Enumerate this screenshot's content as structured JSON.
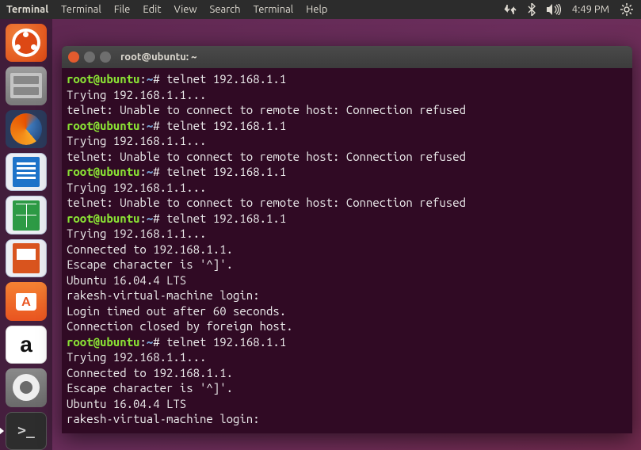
{
  "menubar": {
    "app": "Terminal",
    "items": [
      "Terminal",
      "File",
      "Edit",
      "View",
      "Search",
      "Terminal",
      "Help"
    ],
    "time": "4:49 PM"
  },
  "launcher": {
    "items": [
      {
        "name": "dash"
      },
      {
        "name": "files"
      },
      {
        "name": "firefox"
      },
      {
        "name": "writer"
      },
      {
        "name": "calc"
      },
      {
        "name": "impress"
      },
      {
        "name": "software"
      },
      {
        "name": "amazon"
      },
      {
        "name": "settings"
      },
      {
        "name": "terminal"
      }
    ]
  },
  "window": {
    "title": "root@ubuntu: ~",
    "prompt": {
      "user": "root@ubuntu",
      "path": "~",
      "symbol": "#"
    },
    "session": [
      {
        "cmd": "telnet 192.168.1.1",
        "out": [
          "Trying 192.168.1.1...",
          "telnet: Unable to connect to remote host: Connection refused"
        ]
      },
      {
        "cmd": "telnet 192.168.1.1",
        "out": [
          "Trying 192.168.1.1...",
          "telnet: Unable to connect to remote host: Connection refused"
        ]
      },
      {
        "cmd": "telnet 192.168.1.1",
        "out": [
          "Trying 192.168.1.1...",
          "telnet: Unable to connect to remote host: Connection refused"
        ]
      },
      {
        "cmd": "telnet 192.168.1.1",
        "out": [
          "Trying 192.168.1.1...",
          "Connected to 192.168.1.1.",
          "Escape character is '^]'.",
          "Ubuntu 16.04.4 LTS",
          "rakesh-virtual-machine login:",
          "Login timed out after 60 seconds.",
          "Connection closed by foreign host."
        ]
      },
      {
        "cmd": "telnet 192.168.1.1",
        "out": [
          "Trying 192.168.1.1...",
          "Connected to 192.168.1.1.",
          "Escape character is '^]'.",
          "Ubuntu 16.04.4 LTS",
          "rakesh-virtual-machine login:"
        ]
      }
    ]
  }
}
